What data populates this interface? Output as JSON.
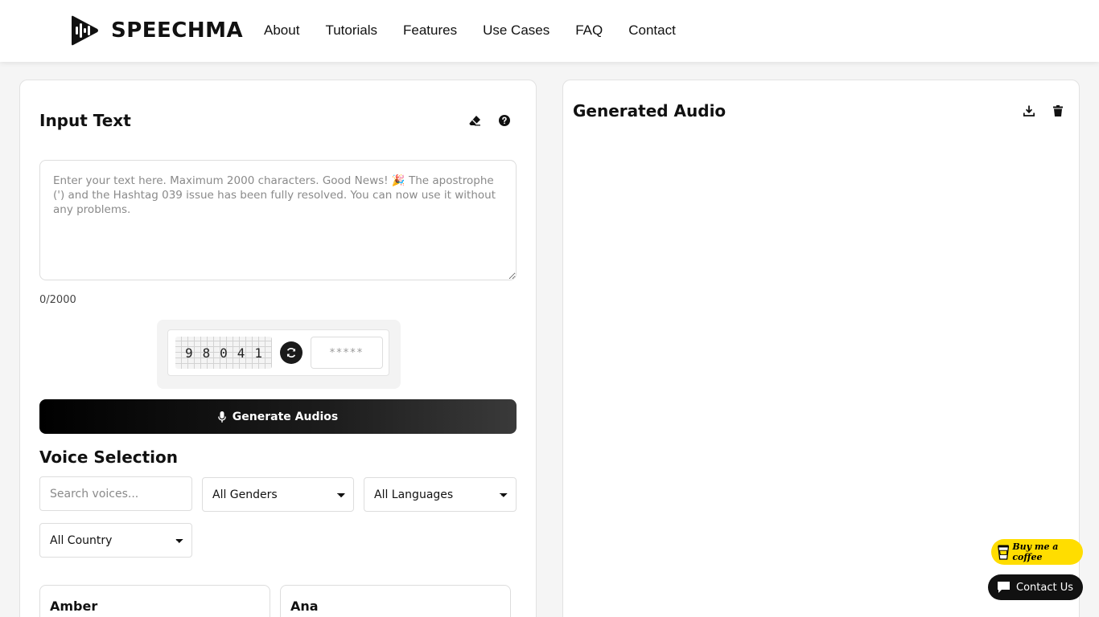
{
  "header": {
    "brand": "SPEECHMA",
    "nav": [
      "About",
      "Tutorials",
      "Features",
      "Use Cases",
      "FAQ",
      "Contact"
    ]
  },
  "input_panel": {
    "title": "Input Text",
    "textarea_placeholder": "Enter your text here. Maximum 2000 characters. Good News! 🎉 The apostrophe (') and the Hashtag 039 issue has been fully resolved. You can now use it without any problems.",
    "counter": "0/2000",
    "captcha": {
      "digits": [
        "9",
        "8",
        "0",
        "4",
        "1"
      ],
      "input_placeholder": "*****"
    },
    "generate_label": "Generate Audios"
  },
  "voice_selection": {
    "title": "Voice Selection",
    "search_placeholder": "Search voices...",
    "gender_selected": "All Genders",
    "language_selected": "All Languages",
    "country_selected": "All Country",
    "voices": [
      "Amber",
      "Ana"
    ]
  },
  "output_panel": {
    "title": "Generated Audio"
  },
  "floating": {
    "coffee_label": "Buy me a coffee",
    "contact_label": "Contact Us"
  },
  "colors": {
    "accent": "#111111",
    "coffee_bg": "#ffdd00"
  }
}
